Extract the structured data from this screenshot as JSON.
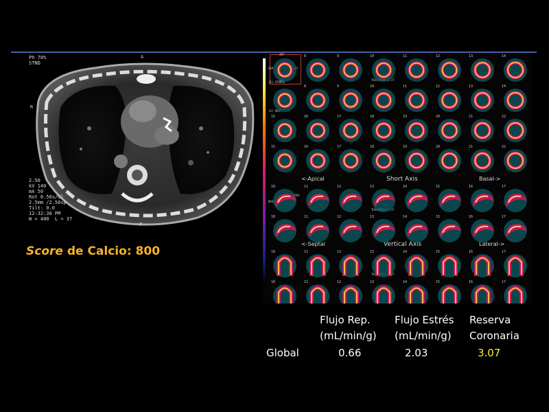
{
  "ct": {
    "overlay_top": [
      "Ph 70%",
      "STND"
    ],
    "overlay_bottom": [
      "2.50",
      "kV 140",
      "mA 50",
      "Rot 0.50s/Cl",
      "2.5mm /2.50sp",
      "Tilt: 0.0",
      "12:32:36 PM",
      "W = 400  L = 37"
    ],
    "orientation_r": "R",
    "orientation_p": "P",
    "orientation_a": "A"
  },
  "score": {
    "prefix": "Score",
    "rest": " de Calcio: 800"
  },
  "spect": {
    "short_axis": {
      "left": "<-Apical",
      "center": "Short Axis",
      "right": "Basal->"
    },
    "vertical_axis": {
      "left": "<-Septal",
      "center": "Vertical Axis",
      "right": "Lateral->"
    },
    "slice_numbers": {
      "row1": [
        "",
        "8",
        "9",
        "10",
        "11",
        "12",
        "13",
        "14"
      ],
      "row2": [
        "",
        "8",
        "9",
        "10",
        "11",
        "12",
        "13",
        "14"
      ],
      "row3": [
        "15",
        "16",
        "17",
        "18",
        "19",
        "20",
        "21",
        "22"
      ],
      "row4": [
        "15",
        "16",
        "17",
        "18",
        "19",
        "20",
        "21",
        "22"
      ],
      "row5": [
        "10",
        "11",
        "12",
        "13",
        "14",
        "15",
        "16",
        "17"
      ],
      "row6": [
        "10",
        "11",
        "12",
        "13",
        "14",
        "15",
        "16",
        "17"
      ],
      "row7": [
        "10",
        "11",
        "12",
        "13",
        "14",
        "15",
        "16",
        "17"
      ],
      "row8": [
        "10",
        "11",
        "12",
        "13",
        "14",
        "15",
        "16",
        "17"
      ]
    },
    "side_labels": {
      "ant": "ANT",
      "sep": "SEP",
      "lat": "LAT",
      "inf": "INF",
      "base": "BASE",
      "apex": "APEX",
      "stress": "(S) STRESS",
      "rest": "(G) REST",
      "thickness": "THICKNESS 3.27"
    }
  },
  "table": {
    "headers": [
      {
        "line1": "Flujo Rep.",
        "line2": "(mL/min/g)"
      },
      {
        "line1": "Flujo Estrés",
        "line2": "(mL/min/g)"
      },
      {
        "line1": "Reserva",
        "line2": "Coronaria"
      }
    ],
    "row_label": "Global",
    "values": [
      "0.66",
      "2.03",
      "3.07"
    ],
    "highlight_color": "#ffef3a"
  }
}
